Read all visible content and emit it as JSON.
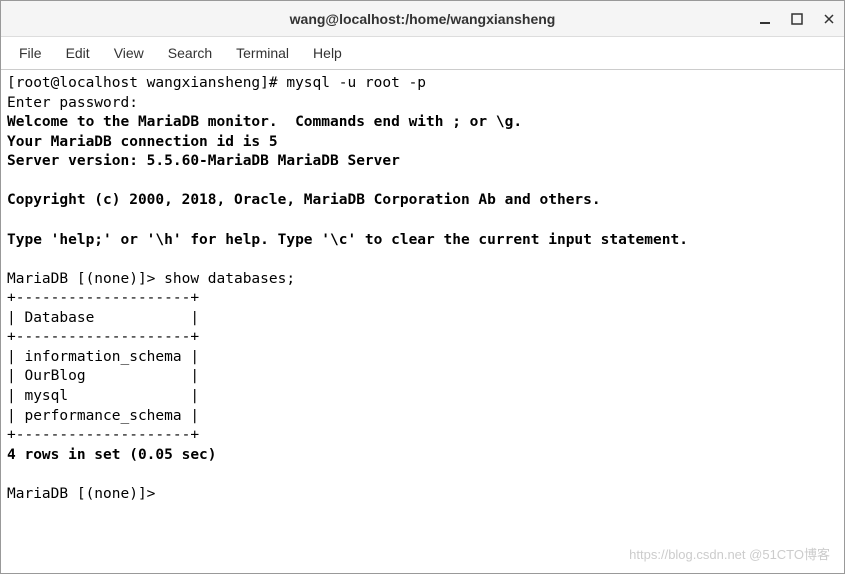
{
  "window": {
    "title": "wang@localhost:/home/wangxiansheng"
  },
  "menubar": {
    "items": [
      "File",
      "Edit",
      "View",
      "Search",
      "Terminal",
      "Help"
    ]
  },
  "terminal": {
    "prompt1": "[root@localhost wangxiansheng]# mysql -u root -p",
    "line_enter_pw": "Enter password:",
    "welcome1": "Welcome to the MariaDB monitor.  Commands end with ; or \\g.",
    "welcome2": "Your MariaDB connection id is 5",
    "welcome3": "Server version: 5.5.60-MariaDB MariaDB Server",
    "copyright": "Copyright (c) 2000, 2018, Oracle, MariaDB Corporation Ab and others.",
    "help": "Type 'help;' or '\\h' for help. Type '\\c' to clear the current input statement.",
    "query_prompt": "MariaDB [(none)]> show databases;",
    "table_border": "+--------------------+",
    "table_header": "| Database           |",
    "table_rows": [
      "| information_schema |",
      "| OurBlog            |",
      "| mysql              |",
      "| performance_schema |"
    ],
    "result_summary": "4 rows in set (0.05 sec)",
    "final_prompt": "MariaDB [(none)]>"
  },
  "watermark": "https://blog.csdn.net @51CTO博客"
}
